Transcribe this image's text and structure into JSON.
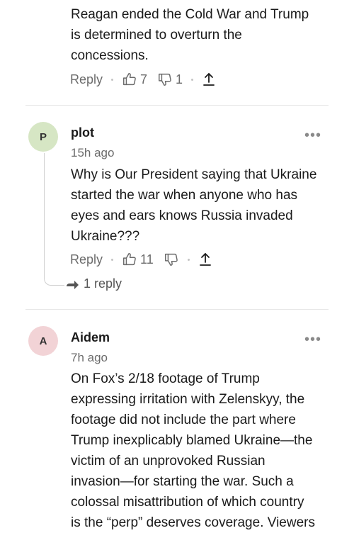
{
  "comment_top": {
    "lines": [
      "Reagan ended the Cold War and Trump",
      "is determined to overturn the",
      "concessions."
    ],
    "reply_label": "Reply",
    "likes": "7",
    "dislikes": "1"
  },
  "comment_plot": {
    "avatar_letter": "P",
    "avatar_color": "#d6e6c4",
    "author": "plot",
    "time": "15h ago",
    "lines": [
      "Why is Our President saying that Ukraine",
      "started the war when anyone who has",
      "eyes and ears knows Russia invaded",
      "Ukraine???"
    ],
    "reply_label": "Reply",
    "likes": "11",
    "replies_label": "1 reply",
    "more_label": "•••"
  },
  "comment_aidem": {
    "avatar_letter": "A",
    "avatar_color": "#f2d3d6",
    "author": "Aidem",
    "time": "7h ago",
    "lines": [
      "On Fox’s 2/18 footage of Trump",
      "expressing irritation with Zelenskyy, the",
      "footage did not include the part where",
      "Trump inexplicably blamed Ukraine—the",
      "victim of an unprovoked Russian",
      "invasion—for starting the war. Such a",
      "colossal misattribution of which country",
      "is the “perp” deserves coverage. Viewers"
    ],
    "more_label": "•••"
  }
}
